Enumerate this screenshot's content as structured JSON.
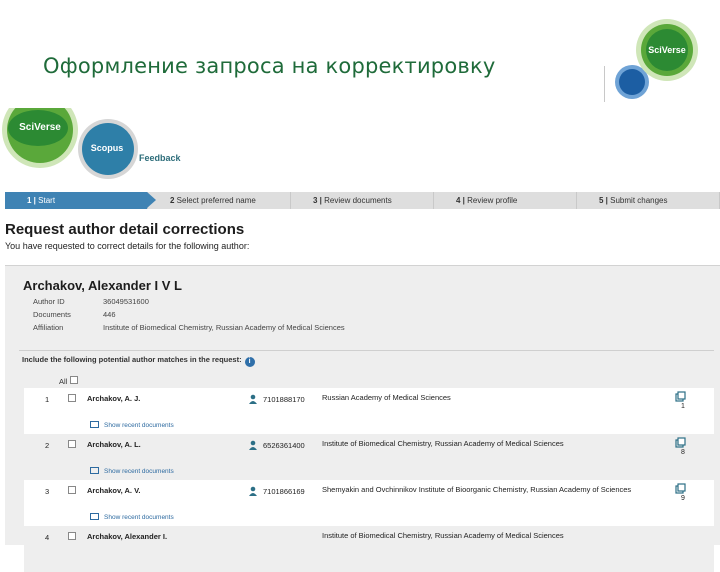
{
  "slide": {
    "title": "Оформление запроса на корректировку",
    "corner_logo_text": "SciVerse"
  },
  "brand": {
    "sciverse": "SciVerse",
    "scopus": "Scopus",
    "feedback": "Feedback"
  },
  "steps": [
    {
      "num": "1 | ",
      "label": "Start",
      "active": true
    },
    {
      "num": "2 ",
      "label": "Select preferred name",
      "active": false
    },
    {
      "num": "3 | ",
      "label": "Review documents",
      "active": false
    },
    {
      "num": "4 | ",
      "label": "Review profile",
      "active": false
    },
    {
      "num": "5 | ",
      "label": "Submit changes",
      "active": false
    }
  ],
  "request": {
    "title": "Request author detail corrections",
    "subtitle": "You have requested to correct details for the following author:"
  },
  "author": {
    "name": "Archakov, Alexander I V L",
    "id_label": "Author ID",
    "id_value": "36049531600",
    "docs_label": "Documents",
    "docs_value": "446",
    "aff_label": "Affiliation",
    "aff_value": "Institute of Biomedical Chemistry, Russian Academy of Medical Sciences"
  },
  "matches": {
    "include_label": "Include the following potential author matches in the request:",
    "all_label": "All",
    "show_recent": "Show recent documents",
    "rows": [
      {
        "num": "1",
        "name": "Archakov, A. J.",
        "id": "7101888170",
        "aff": "Russian Academy of Medical Sciences",
        "count": "1",
        "style": "white"
      },
      {
        "num": "2",
        "name": "Archakov, A. L.",
        "id": "6526361400",
        "aff": "Institute of Biomedical Chemistry, Russian Academy of Medical Sciences",
        "count": "8",
        "style": "gray"
      },
      {
        "num": "3",
        "name": "Archakov, A. V.",
        "id": "7101866169",
        "aff": "Shemyakin and Ovchinnikov Institute of Bioorganic Chemistry, Russian Academy of Sciences",
        "count": "9",
        "style": "white"
      },
      {
        "num": "4",
        "name": "Archakov, Alexander I.",
        "id": "",
        "aff": "Institute of Biomedical Chemistry, Russian Academy of Medical Sciences",
        "count": "",
        "style": "gray"
      }
    ]
  },
  "colors": {
    "title_green": "#1f6b3a",
    "step_active": "#3f83b4",
    "link_blue": "#2d6aa0"
  }
}
